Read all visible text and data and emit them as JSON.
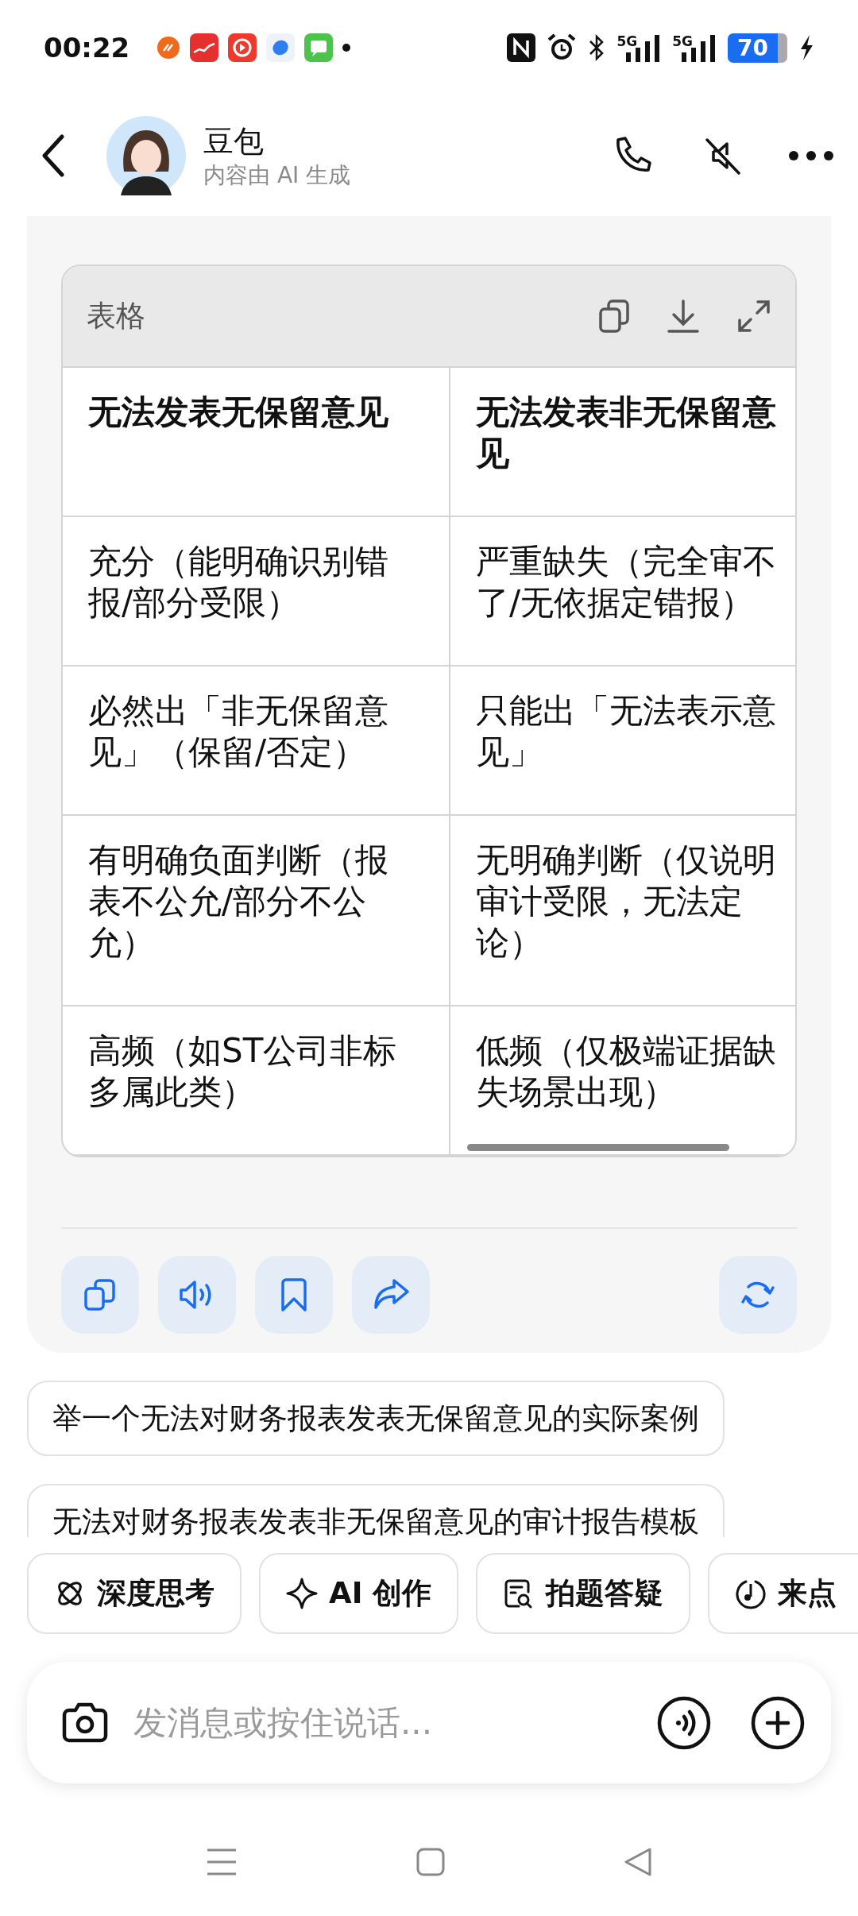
{
  "status_bar": {
    "time": "00:22",
    "signals": [
      {
        "label": "5G"
      },
      {
        "label": "5G"
      }
    ],
    "battery": "70"
  },
  "header": {
    "title": "豆包",
    "subtitle": "内容由 AI 生成"
  },
  "table": {
    "title": "表格",
    "columns": [
      "无法发表无保留意见",
      "无法发表非无保留意见"
    ],
    "rows": [
      [
        "充分（能明确识别错报/部分受限）",
        "严重缺失（完全审不了/无依据定错报）"
      ],
      [
        "必然出「非无保留意见」（保留/否定）",
        "只能出「无法表示意见」"
      ],
      [
        "有明确负面判断（报表不公允/部分不公允）",
        "无明确判断（仅说明审计受限，无法定论）"
      ],
      [
        "高频（如ST公司非标多属此类）",
        "低频（仅极端证据缺失场景出现）"
      ]
    ]
  },
  "suggestions": [
    "举一个无法对财务报表发表无保留意见的实际案例",
    "无法对财务报表发表非无保留意见的审计报告模板"
  ],
  "chips": [
    "深度思考",
    "AI 创作",
    "拍题答疑",
    "来点"
  ],
  "input": {
    "placeholder": "发消息或按住说话..."
  }
}
